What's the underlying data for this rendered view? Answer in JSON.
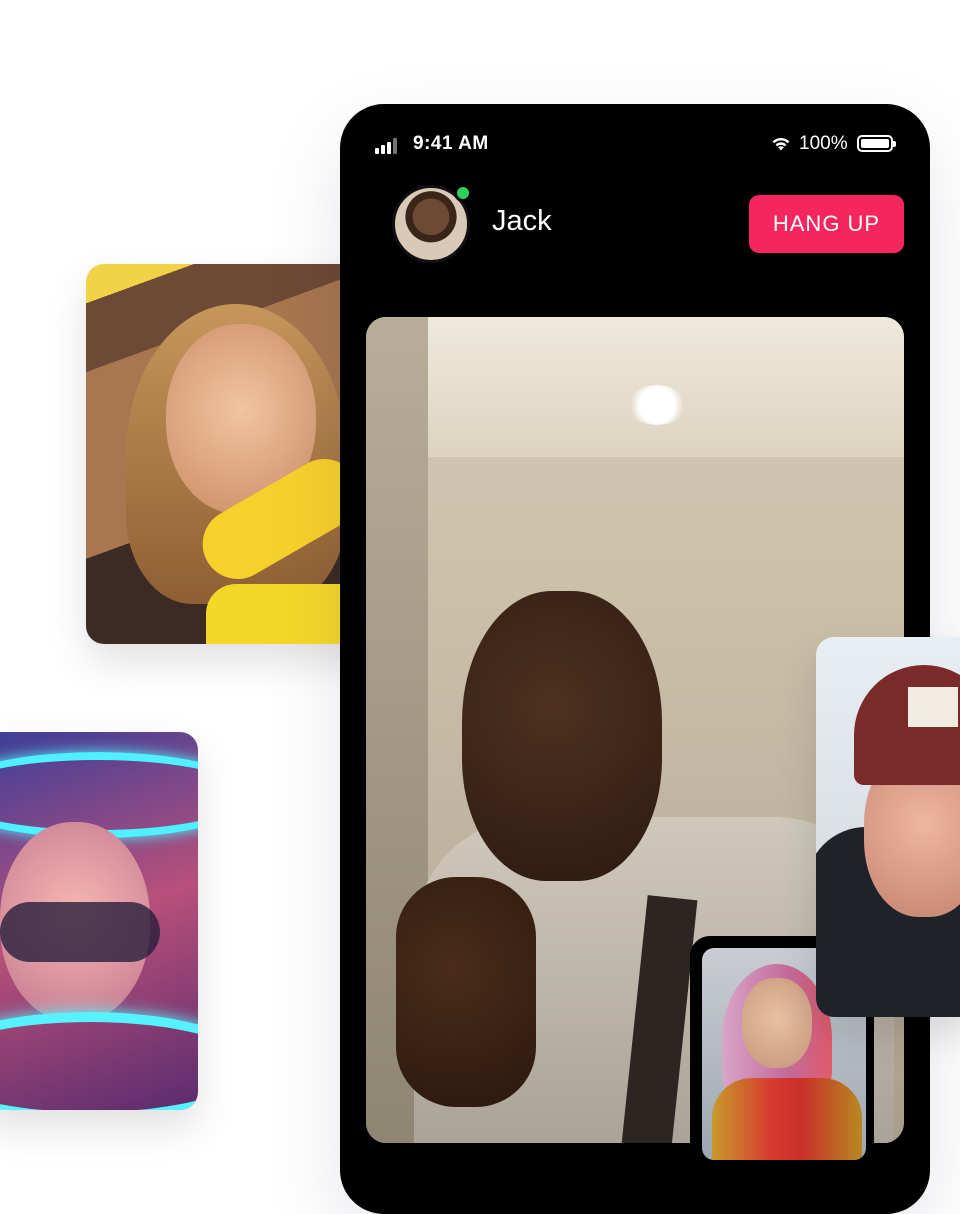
{
  "status_bar": {
    "time": "9:41 AM",
    "battery": "100%"
  },
  "call": {
    "caller_name": "Jack",
    "hang_up_label": "HANG UP",
    "online_color": "#2ed158",
    "hang_up_color": "#f5255e"
  },
  "icons": [
    "signal-icon",
    "wifi-icon",
    "battery-icon"
  ]
}
